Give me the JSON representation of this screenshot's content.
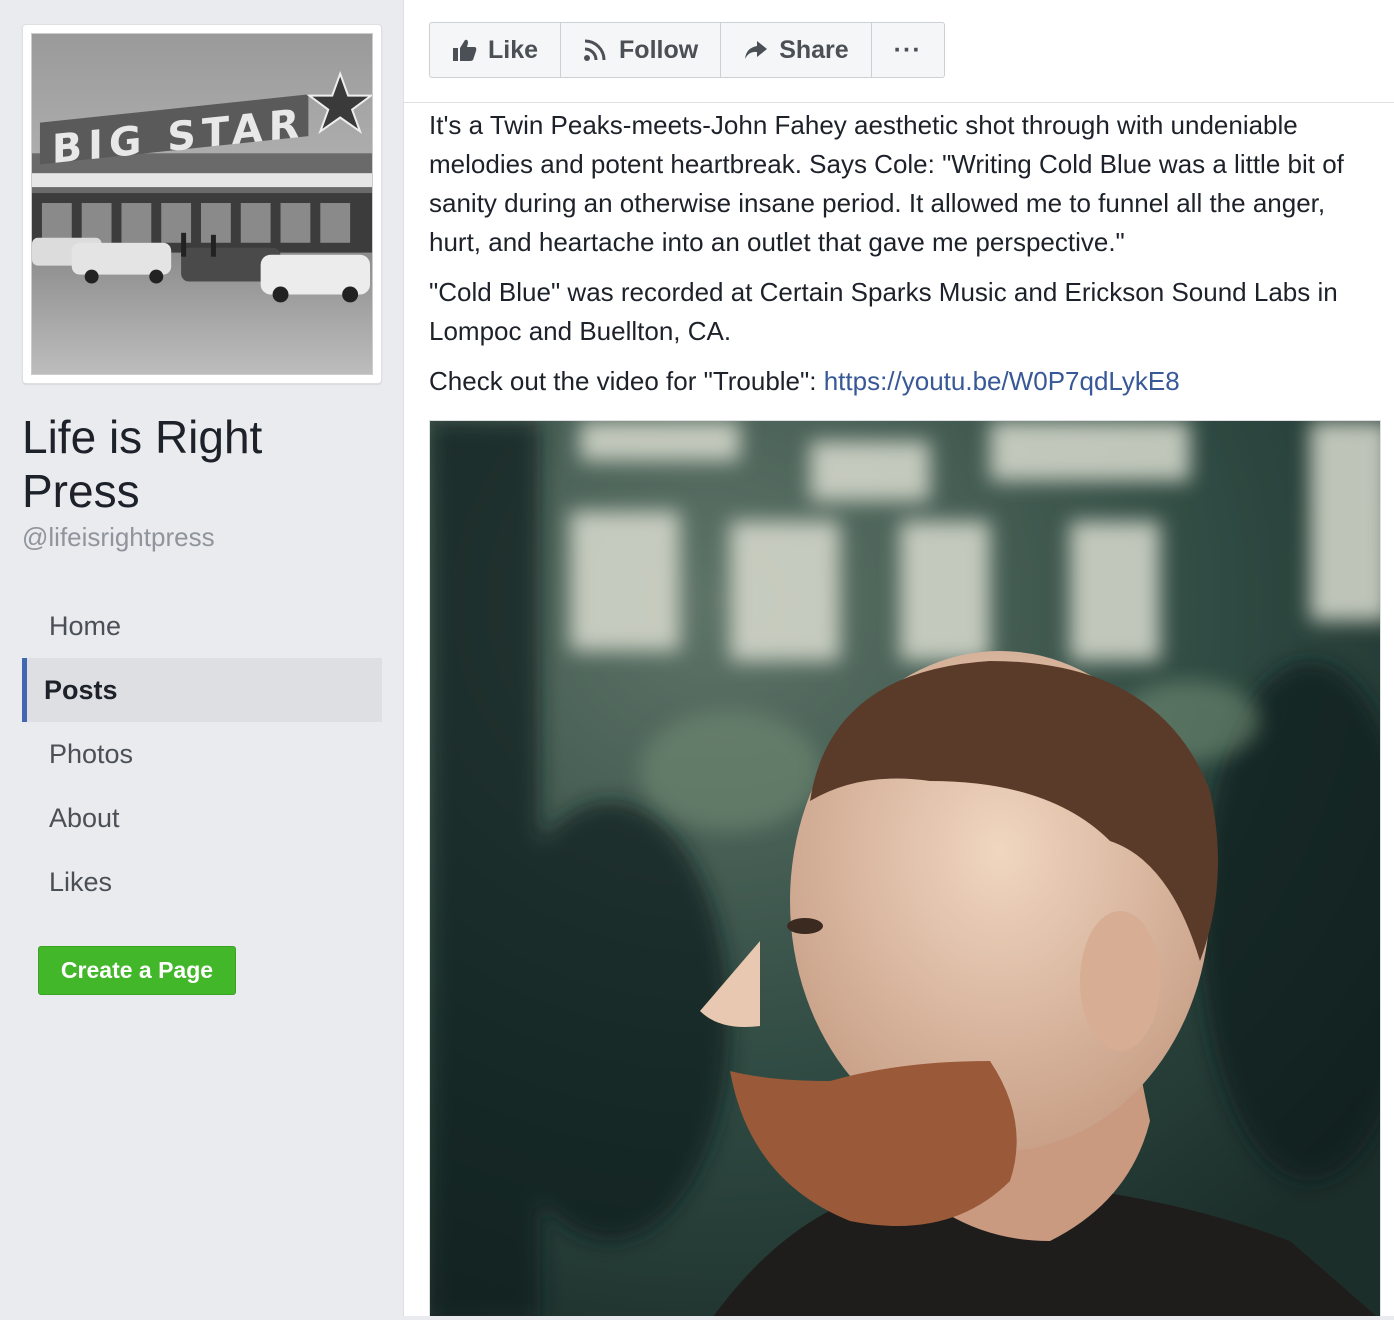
{
  "sidebar": {
    "page_name": "Life is Right Press",
    "handle": "@lifeisrightpress",
    "profile_image_sign": "BIG STAR",
    "nav": [
      {
        "label": "Home",
        "active": false
      },
      {
        "label": "Posts",
        "active": true
      },
      {
        "label": "Photos",
        "active": false
      },
      {
        "label": "About",
        "active": false
      },
      {
        "label": "Likes",
        "active": false
      }
    ],
    "create_page_label": "Create a Page",
    "create_page_color": "#42b72a",
    "active_accent": "#4267b2"
  },
  "actions": {
    "like_label": "Like",
    "like_icon": "thumbs-up-icon",
    "follow_label": "Follow",
    "follow_icon": "rss-icon",
    "share_label": "Share",
    "share_icon": "share-arrow-icon",
    "more_label": "···",
    "more_icon": "more-dots-icon"
  },
  "post": {
    "paragraph1": "It's a Twin Peaks-meets-John Fahey aesthetic shot through with undeniable melodies and potent heartbreak. Says Cole: \"Writing Cold Blue was a little bit of sanity during an otherwise insane period. It allowed me to funnel all the anger, hurt, and heartache into an outlet that gave me perspective.\"",
    "paragraph2": "\"Cold Blue\" was recorded at Certain Sparks Music and Erickson Sound Labs in Lompoc and Buellton, CA.",
    "paragraph3_prefix": "Check out the video for \"Trouble\": ",
    "link_text": "https://youtu.be/W0P7qdLykE8",
    "link_color": "#385898"
  }
}
